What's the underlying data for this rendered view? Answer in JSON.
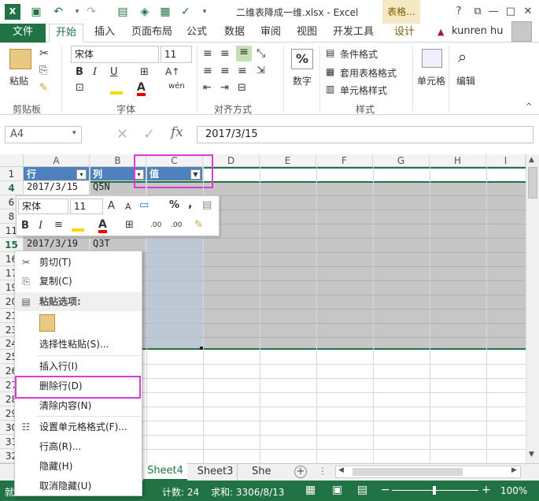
{
  "window": {
    "title": "二维表降成一维.xlsx - Excel",
    "context_tab": "表格...",
    "help": "?",
    "restore": "⧉",
    "minimize": "—",
    "maximize": "□",
    "close": "✕"
  },
  "tabs": [
    "文件",
    "开始",
    "插入",
    "页面布局",
    "公式",
    "数据",
    "审阅",
    "视图",
    "开发工具",
    "设计"
  ],
  "user": "kunren hu",
  "ribbon": {
    "clipboard": {
      "paste": "粘贴",
      "label": "剪贴板"
    },
    "font": {
      "name": "宋体",
      "size": "11",
      "label": "字体",
      "bold": "B",
      "italic": "I",
      "underline": "U"
    },
    "align": {
      "label": "对齐方式"
    },
    "number": {
      "btn": "数字",
      "symbol": "%"
    },
    "styles": {
      "cond": "条件格式",
      "table": "套用表格格式",
      "cell": "单元格样式",
      "label": "样式"
    },
    "cells": {
      "btn": "单元格"
    },
    "edit": {
      "btn": "编辑"
    }
  },
  "formula_bar": {
    "namebox": "A4",
    "fx": "fx",
    "value": "2017/3/15"
  },
  "columns": [
    "A",
    "B",
    "C",
    "D",
    "E",
    "F",
    "G",
    "H",
    "I"
  ],
  "header_row": {
    "num": "1",
    "a": "行",
    "b": "列",
    "c": "值"
  },
  "rows": [
    {
      "num": "4",
      "a": "2017/3/15",
      "b": "Q5N"
    },
    {
      "num": "15",
      "a": "2017/3/19",
      "b": "Q3T"
    }
  ],
  "row_numbers_partial": [
    "6",
    "8",
    "11",
    "16",
    "17",
    "19",
    "20",
    "21",
    "23",
    "24",
    "25",
    "26",
    "27",
    "28",
    "29",
    "30",
    "31",
    "32",
    "33"
  ],
  "mini_toolbar": {
    "font": "宋体",
    "size": "11",
    "grow": "A",
    "shrink": "A",
    "percent": "%",
    "comma": ",",
    "bold": "B",
    "italic": "I",
    "dec_inc": ".00",
    "dec_dec": ".00"
  },
  "context_menu": {
    "cut": "剪切(T)",
    "copy": "复制(C)",
    "paste_options": "粘贴选项:",
    "paste_special": "选择性粘贴(S)...",
    "insert_row": "插入行(I)",
    "delete_row": "删除行(D)",
    "clear": "清除内容(N)",
    "format_cells": "设置单元格格式(F)...",
    "row_height": "行高(R)...",
    "hide": "隐藏(H)",
    "unhide": "取消隐藏(U)"
  },
  "sheets": {
    "active": "Sheet4",
    "other": "Sheet3",
    "partial": "She"
  },
  "status": {
    "ready": "就",
    "count": "计数: 24",
    "sum": "求和: 3306/8/13",
    "zoom": "100%"
  },
  "colors": {
    "excel_green": "#217346",
    "table_header": "#4f81bd",
    "highlight": "#d83bd8",
    "selection": "#c6c6c6"
  }
}
